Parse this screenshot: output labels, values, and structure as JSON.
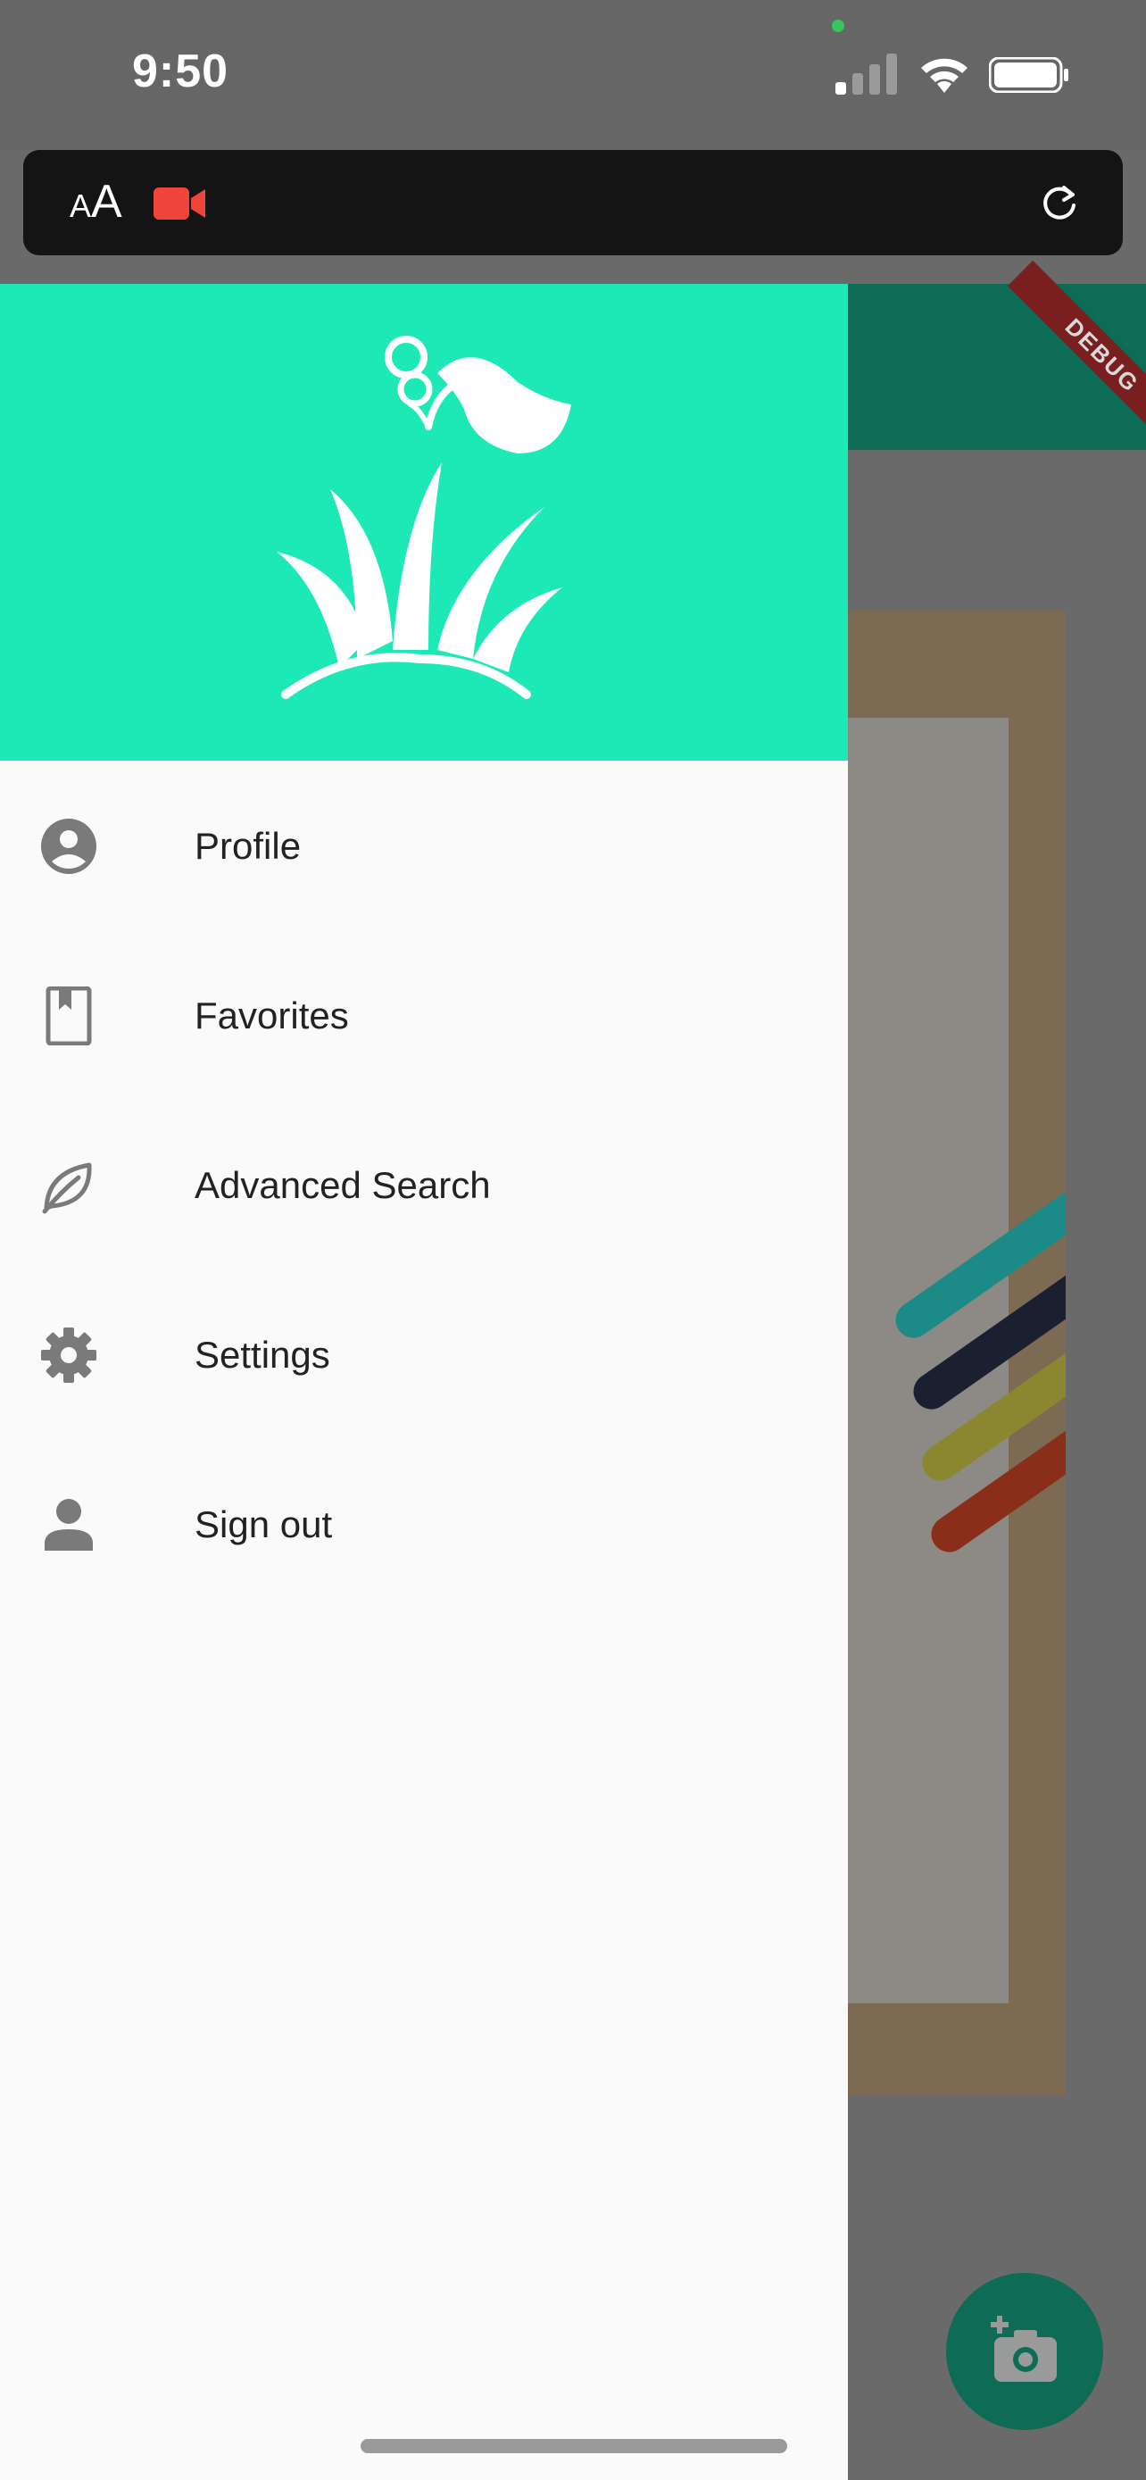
{
  "status_bar": {
    "time": "9:50"
  },
  "browser": {
    "text_size_label_small": "A",
    "text_size_label_large": "A",
    "recording_icon": "video-camera-icon",
    "reload_icon": "reload-icon"
  },
  "app_bar": {
    "debug_banner": "DEBUG"
  },
  "drawer": {
    "header_logo": "plant-logo",
    "header_color": "#1de9b6",
    "items": [
      {
        "label": "Profile",
        "icon": "account-circle-icon"
      },
      {
        "label": "Favorites",
        "icon": "bookmark-icon"
      },
      {
        "label": "Advanced Search",
        "icon": "leaf-icon"
      },
      {
        "label": "Settings",
        "icon": "gear-icon"
      },
      {
        "label": "Sign out",
        "icon": "person-icon"
      }
    ]
  },
  "fab": {
    "icon": "add-photo-icon",
    "color": "#0e6b55"
  }
}
